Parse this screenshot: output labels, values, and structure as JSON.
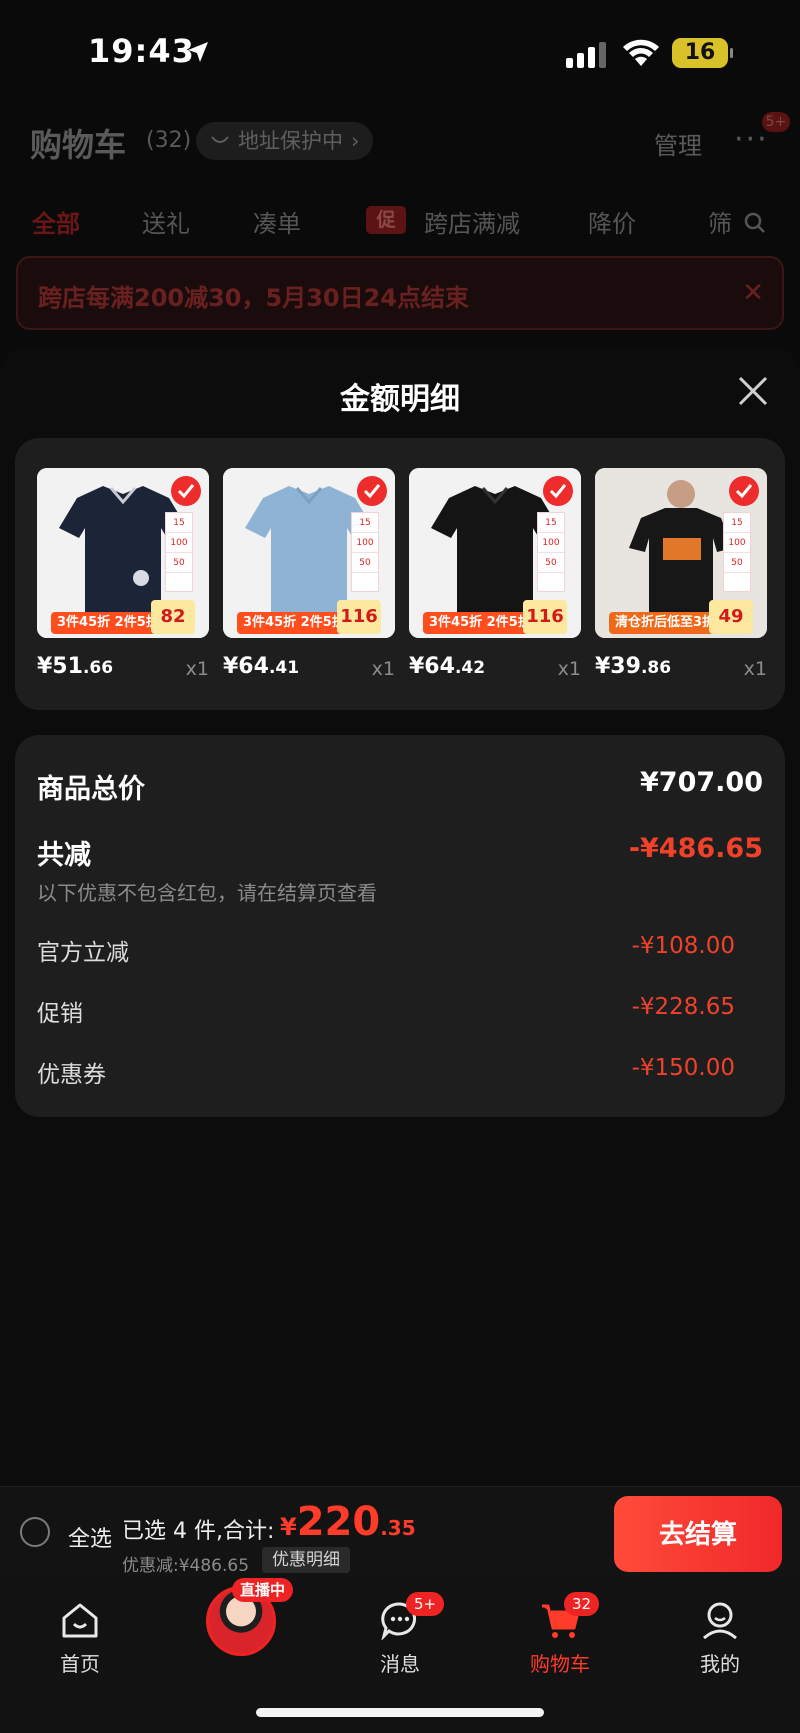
{
  "status_bar": {
    "time": "19:43",
    "battery": "16"
  },
  "cart_header": {
    "title": "购物车",
    "count": "(32)",
    "address_protect": "地址保护中",
    "manage": "管理",
    "more_badge": "5+"
  },
  "filter_tabs": [
    "全部",
    "送礼",
    "凑单",
    "跨店满减",
    "降价",
    "筛"
  ],
  "promo_tag": "促",
  "banner": "跨店每满200减30，5月30日24点结束",
  "sheet": {
    "title": "金额明细"
  },
  "products": [
    {
      "price_int": "¥51",
      "price_dec": ".66",
      "qty": "x1",
      "badge": "82",
      "strip": "3件45折 2件5折"
    },
    {
      "price_int": "¥64",
      "price_dec": ".41",
      "qty": "x1",
      "badge": "116",
      "strip": "3件45折 2件5折"
    },
    {
      "price_int": "¥64",
      "price_dec": ".42",
      "qty": "x1",
      "badge": "116",
      "strip": "3件45折 2件5折"
    },
    {
      "price_int": "¥39",
      "price_dec": ".86",
      "qty": "x1",
      "badge": "49",
      "strip": "清仓折后低至3折"
    }
  ],
  "ladder": [
    "15",
    "100",
    "50"
  ],
  "summary": {
    "total_label": "商品总价",
    "total_value": "¥707.00",
    "reduce_label": "共减",
    "reduce_value": "-¥486.65",
    "note": "以下优惠不包含红包，请在结算页查看",
    "rows": [
      {
        "label": "官方立减",
        "value": "-¥108.00"
      },
      {
        "label": "促销",
        "value": "-¥228.65"
      },
      {
        "label": "优惠券",
        "value": "-¥150.00"
      }
    ]
  },
  "checkout": {
    "select_all": "全选",
    "selected_text": "已选 4 件,合计:",
    "price_yen": "¥",
    "price_int": "220",
    "price_dec": ".35",
    "discount": "优惠减:¥486.65",
    "detail": "优惠明细",
    "button": "去结算"
  },
  "tabbar": {
    "home": "首页",
    "live": "直播中",
    "messages": "消息",
    "messages_badge": "5+",
    "cart": "购物车",
    "cart_badge": "32",
    "mine": "我的"
  },
  "colors": {
    "accent": "#ff3b2a",
    "card": "#1e1e1e",
    "background": "#0a0a0a"
  }
}
